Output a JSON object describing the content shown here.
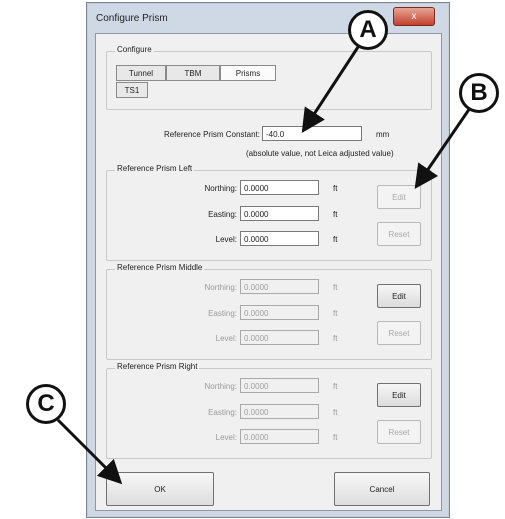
{
  "window": {
    "title": "Configure Prism",
    "close_label": "x"
  },
  "configure": {
    "group_label": "Configure",
    "tabs": [
      {
        "label": "Tunnel"
      },
      {
        "label": "TBM"
      },
      {
        "label": "Prisms"
      },
      {
        "label": "TS1"
      }
    ],
    "active_tab": "Prisms"
  },
  "constant": {
    "label": "Reference Prism Constant:",
    "value": "-40.0",
    "unit": "mm",
    "note": "(absolute value, not Leica adjusted value)"
  },
  "groups": [
    {
      "title": "Reference Prism Left",
      "enabled": true,
      "northing_label": "Northing:",
      "northing": "0.0000",
      "easting_label": "Easting:",
      "easting": "0.0000",
      "level_label": "Level:",
      "level": "0.0000",
      "unit": "ft",
      "edit_label": "Edit",
      "edit_enabled": false,
      "reset_label": "Reset",
      "reset_enabled": false
    },
    {
      "title": "Reference Prism Middle",
      "enabled": false,
      "northing_label": "Northing:",
      "northing": "0.0000",
      "easting_label": "Easting:",
      "easting": "0.0000",
      "level_label": "Level:",
      "level": "0.0000",
      "unit": "ft",
      "edit_label": "Edit",
      "edit_enabled": true,
      "reset_label": "Reset",
      "reset_enabled": false
    },
    {
      "title": "Reference Prism Right",
      "enabled": false,
      "northing_label": "Northing:",
      "northing": "0.0000",
      "easting_label": "Easting:",
      "easting": "0.0000",
      "level_label": "Level:",
      "level": "0.0000",
      "unit": "ft",
      "edit_label": "Edit",
      "edit_enabled": true,
      "reset_label": "Reset",
      "reset_enabled": false
    }
  ],
  "footer": {
    "ok_label": "OK",
    "cancel_label": "Cancel"
  },
  "callouts": {
    "a": "A",
    "b": "B",
    "c": "C"
  }
}
